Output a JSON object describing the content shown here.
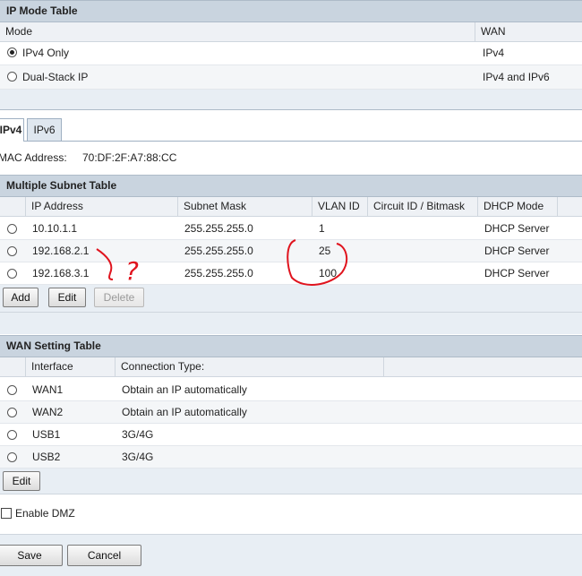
{
  "ip_mode": {
    "title": "IP Mode Table",
    "headers": {
      "mode": "Mode",
      "wan": "WAN"
    },
    "rows": [
      {
        "mode": "IPv4 Only",
        "wan": "IPv4",
        "selected": true
      },
      {
        "mode": "Dual-Stack IP",
        "wan": "IPv4 and IPv6",
        "selected": false
      }
    ]
  },
  "tabs": [
    {
      "label": "IPv4",
      "active": true
    },
    {
      "label": "IPv6",
      "active": false
    }
  ],
  "mac": {
    "label": "MAC Address:",
    "value": "70:DF:2F:A7:88:CC"
  },
  "subnet": {
    "title": "Multiple Subnet Table",
    "headers": [
      "IP Address",
      "Subnet Mask",
      "VLAN ID",
      "Circuit ID / Bitmask",
      "DHCP Mode"
    ],
    "rows": [
      {
        "ip": "10.10.1.1",
        "mask": "255.255.255.0",
        "vlan": "1",
        "circuit": "",
        "dhcp": "DHCP Server"
      },
      {
        "ip": "192.168.2.1",
        "mask": "255.255.255.0",
        "vlan": "25",
        "circuit": "",
        "dhcp": "DHCP Server"
      },
      {
        "ip": "192.168.3.1",
        "mask": "255.255.255.0",
        "vlan": "100",
        "circuit": "",
        "dhcp": "DHCP Server"
      }
    ],
    "buttons": {
      "add": "Add",
      "edit": "Edit",
      "delete": "Delete"
    }
  },
  "annotation": {
    "mark": "?",
    "color": "#e0141e"
  },
  "wan": {
    "title": "WAN Setting Table",
    "headers": {
      "interface": "Interface",
      "connection": "Connection Type:"
    },
    "rows": [
      {
        "interface": "WAN1",
        "connection": "Obtain an IP automatically"
      },
      {
        "interface": "WAN2",
        "connection": "Obtain an IP automatically"
      },
      {
        "interface": "USB1",
        "connection": "3G/4G"
      },
      {
        "interface": "USB2",
        "connection": "3G/4G"
      }
    ],
    "edit": "Edit"
  },
  "dmz": {
    "label": "Enable DMZ",
    "checked": false
  },
  "footer": {
    "save": "Save",
    "cancel": "Cancel"
  }
}
